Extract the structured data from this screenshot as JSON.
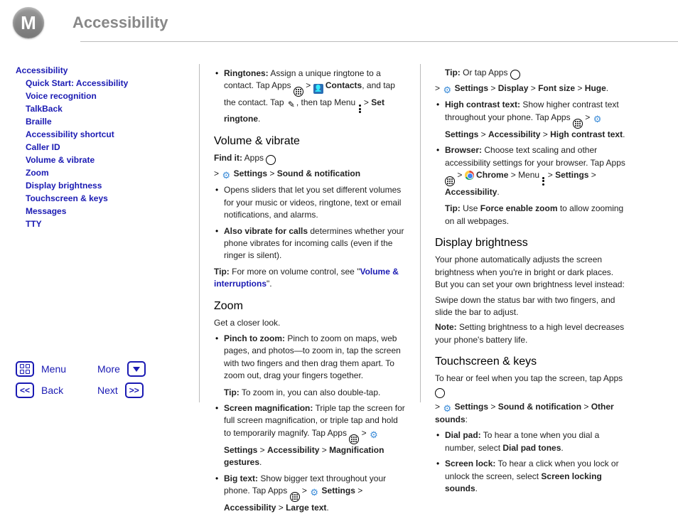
{
  "header": {
    "title": "Accessibility"
  },
  "sidebar": {
    "root": "Accessibility",
    "items": [
      "Quick Start: Accessibility",
      "Voice recognition",
      "TalkBack",
      "Braille",
      "Accessibility shortcut",
      "Caller ID",
      "Volume & vibrate",
      "Zoom",
      "Display brightness",
      "Touchscreen & keys",
      "Messages",
      "TTY"
    ]
  },
  "bottomnav": {
    "menu": "Menu",
    "more": "More",
    "back": "Back",
    "next": "Next"
  },
  "col1": {
    "ringtones_bold": "Ringtones:",
    "ringtones_text1": " Assign a unique ringtone to a contact. Tap Apps ",
    "ringtones_contacts": " Contacts",
    "ringtones_text2": ", and tap the contact. Tap ",
    "ringtones_text3": ", then tap Menu ",
    "ringtones_setringtone": "Set ringtone",
    "vol_heading": "Volume & vibrate",
    "vol_findit_label": "Find it:",
    "vol_findit_apps": " Apps ",
    "vol_settings": " Settings",
    "vol_sound": "Sound & notification",
    "vol_li1": "Opens sliders that let you set different volumes for your music or videos, ringtone, text or email notifications, and alarms.",
    "vol_li2_bold": "Also vibrate for calls",
    "vol_li2_text": " determines whether your phone vibrates for incoming calls (even if the ringer is silent).",
    "vol_tip_label": "Tip:",
    "vol_tip_text": " For more on volume control, see \"",
    "vol_tip_link": "Volume & interruptions",
    "vol_tip_end": "\".",
    "zoom_heading": "Zoom",
    "zoom_sub": "Get a closer look.",
    "zoom_li1_bold": "Pinch to zoom:",
    "zoom_li1_text": " Pinch to zoom on maps, web pages, and photos—to zoom in, tap the screen with two fingers and then drag them apart. To zoom out, drag your fingers together.",
    "zoom_li1_tip_label": "Tip:",
    "zoom_li1_tip_text": " To zoom in, you can also double-tap.",
    "zoom_li2_bold": "Screen magnification:",
    "zoom_li2_text": " Triple tap the screen for full screen magnification, or triple tap and hold to temporarily magnify. Tap Apps ",
    "zoom_li2_settings": " Settings",
    "zoom_li2_access": "Accessibility",
    "zoom_li2_mag": "Magnification gestures",
    "zoom_li3_bold": "Big text:",
    "zoom_li3_text": " Show bigger text throughout your phone. Tap Apps ",
    "zoom_li3_settings": " Settings",
    "zoom_li3_access": "Accessibility",
    "zoom_li3_large": "Large text"
  },
  "col2": {
    "tip1_label": "Tip:",
    "tip1_text": " Or tap Apps ",
    "tip1_settings": " Settings",
    "tip1_display": "Display",
    "tip1_fontsize": "Font size",
    "tip1_huge": "Huge",
    "hc_bold": "High contrast text:",
    "hc_text": " Show higher contrast text throughout your phone. Tap Apps ",
    "hc_settings": " Settings",
    "hc_access": "Accessibility",
    "hc_hctext": "High contrast text",
    "br_bold": "Browser:",
    "br_text": " Choose text scaling and other accessibility settings for your browser. Tap Apps ",
    "br_chrome": " Chrome",
    "br_menu": "Menu ",
    "br_settings": "Settings",
    "br_access": "Accessibility",
    "br_tip_label": "Tip:",
    "br_tip_text1": " Use ",
    "br_tip_force": "Force enable zoom",
    "br_tip_text2": " to allow zooming on all webpages.",
    "db_heading": "Display brightness",
    "db_p1": "Your phone automatically adjusts the screen brightness when you're in bright or dark places. But you can set your own brightness level instead:",
    "db_p2": "Swipe down the status bar with two fingers, and slide the bar to adjust.",
    "db_note_label": "Note:",
    "db_note_text": " Setting brightness to a high level decreases your phone's battery life.",
    "tk_heading": "Touchscreen & keys",
    "tk_intro": "To hear or feel when you tap the screen, tap Apps ",
    "tk_settings": " Settings",
    "tk_sound": "Sound & notification",
    "tk_other": "Other sounds",
    "tk_li1_bold": "Dial pad:",
    "tk_li1_text": " To hear a tone when you dial a number, select ",
    "tk_li1_dial": "Dial pad tones",
    "tk_li2_bold": "Screen lock:",
    "tk_li2_text": " To hear a click when you lock or unlock the screen, select ",
    "tk_li2_lock": "Screen locking sounds"
  }
}
